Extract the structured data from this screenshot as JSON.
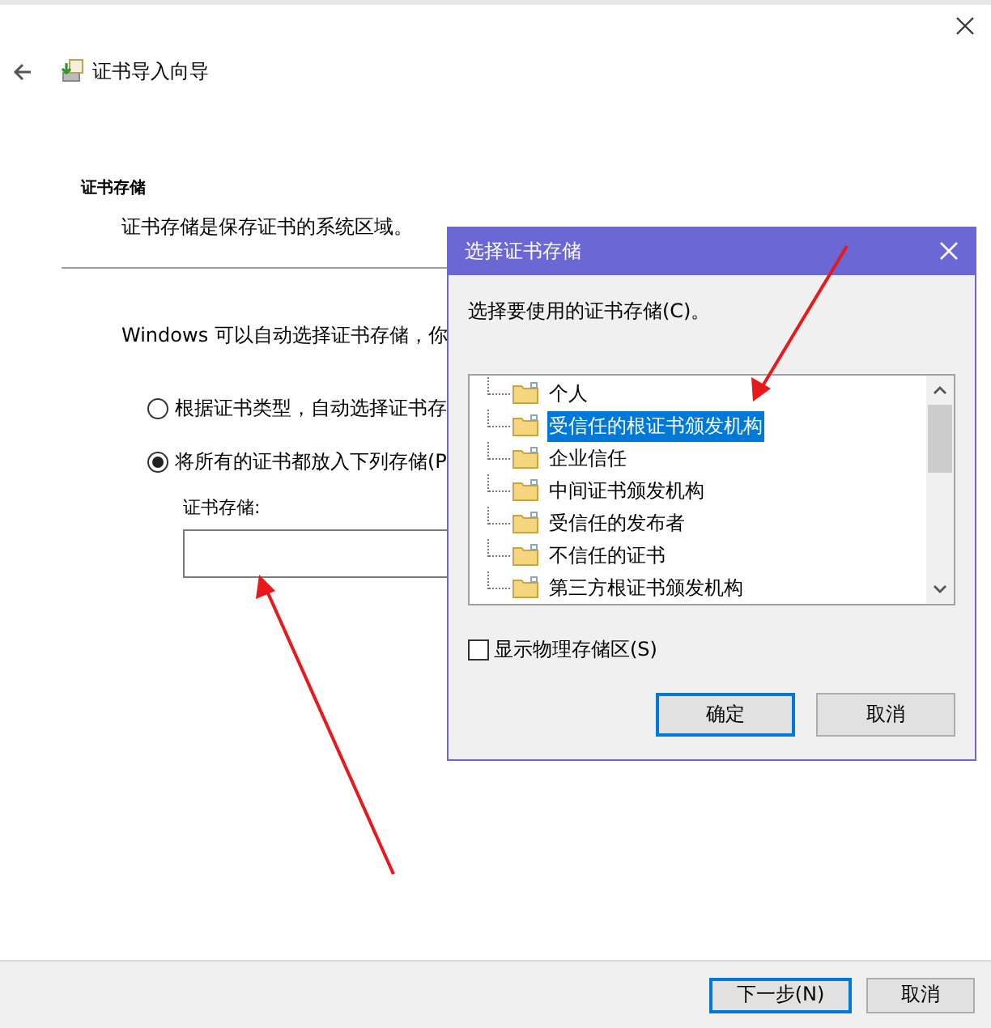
{
  "wizard": {
    "title": "证书导入向导",
    "section_title": "证书存储",
    "section_description": "证书存储是保存证书的系统区域。",
    "intro": "Windows 可以自动选择证书存储，你",
    "options": [
      {
        "label": "根据证书类型，自动选择证书存",
        "selected": false
      },
      {
        "label": "将所有的证书都放入下列存储(P",
        "selected": true
      }
    ],
    "store_label": "证书存储:",
    "buttons": [
      {
        "label": "下一步(N)",
        "focused": true
      },
      {
        "label": "取消",
        "focused": false
      }
    ]
  },
  "dialog": {
    "title": "选择证书存储",
    "prompt": "选择要使用的证书存储(C)。",
    "tree": [
      {
        "label": "个人",
        "selected": false
      },
      {
        "label": "受信任的根证书颁发机构",
        "selected": true
      },
      {
        "label": "企业信任",
        "selected": false
      },
      {
        "label": "中间证书颁发机构",
        "selected": false
      },
      {
        "label": "受信任的发布者",
        "selected": false
      },
      {
        "label": "不信任的证书",
        "selected": false
      },
      {
        "label": "第三方根证书颁发机构",
        "selected": false
      }
    ],
    "show_physical": {
      "label": "显示物理存储区(S)",
      "checked": false
    },
    "buttons": [
      {
        "label": "确定",
        "focused": true
      },
      {
        "label": "取消",
        "focused": false
      }
    ]
  }
}
